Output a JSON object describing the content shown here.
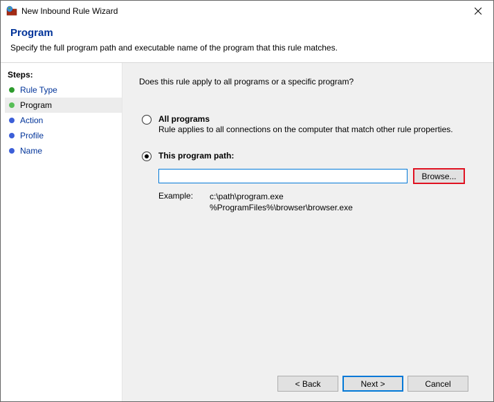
{
  "window": {
    "title": "New Inbound Rule Wizard"
  },
  "header": {
    "title": "Program",
    "subtitle": "Specify the full program path and executable name of the program that this rule matches."
  },
  "sidebar": {
    "steps_label": "Steps:",
    "items": [
      {
        "label": "Rule Type"
      },
      {
        "label": "Program"
      },
      {
        "label": "Action"
      },
      {
        "label": "Profile"
      },
      {
        "label": "Name"
      }
    ]
  },
  "content": {
    "question": "Does this rule apply to all programs or a specific program?",
    "all_programs": {
      "label": "All programs",
      "desc": "Rule applies to all connections on the computer that match other rule properties."
    },
    "this_program": {
      "label": "This program path:",
      "path_value": "",
      "browse_label": "Browse...",
      "example_label": "Example:",
      "example_line1": "c:\\path\\program.exe",
      "example_line2": "%ProgramFiles%\\browser\\browser.exe"
    }
  },
  "footer": {
    "back": "< Back",
    "next": "Next >",
    "cancel": "Cancel"
  }
}
